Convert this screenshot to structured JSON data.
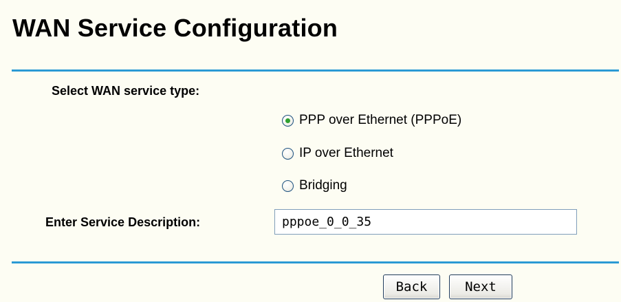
{
  "page": {
    "title": "WAN Service Configuration"
  },
  "service_type": {
    "label": "Select WAN service type:",
    "selected": "pppoe",
    "options": [
      {
        "id": "pppoe",
        "label": "PPP over Ethernet (PPPoE)",
        "checked": true
      },
      {
        "id": "ipoe",
        "label": "IP over Ethernet",
        "checked": false
      },
      {
        "id": "bridging",
        "label": "Bridging",
        "checked": false
      }
    ]
  },
  "description": {
    "label": "Enter Service Description:",
    "value": "pppoe_0_0_35"
  },
  "buttons": {
    "back_label": "Back",
    "next_label": "Next"
  },
  "colors": {
    "background": "#fdfdf3",
    "rule": "#2b9ad4",
    "radio_selected_dot": "#2fa02f"
  }
}
